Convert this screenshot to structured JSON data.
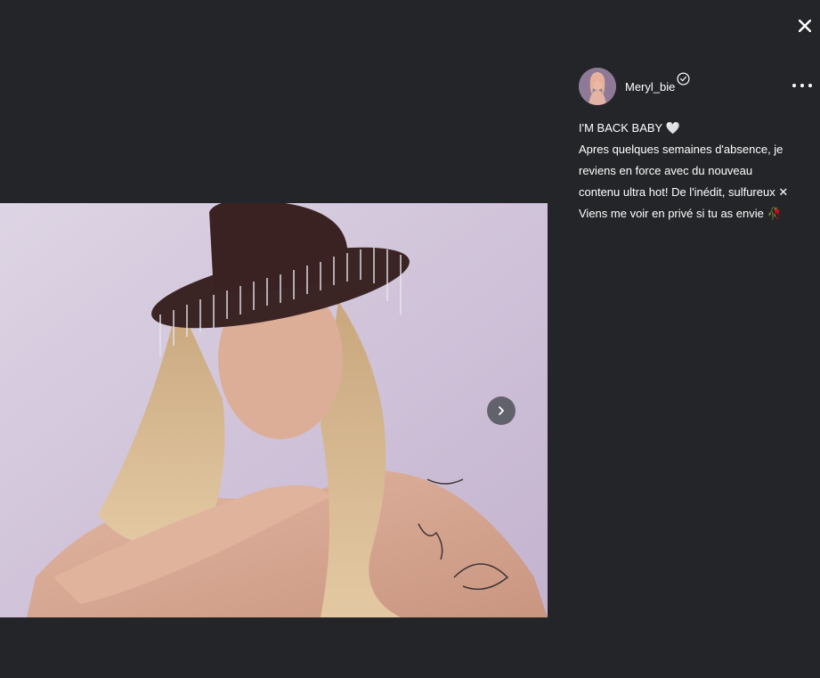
{
  "post": {
    "author": {
      "username": "Meryl_bie",
      "verified": true
    },
    "caption": {
      "line1": "I'M BACK BABY",
      "line1_emoji": "🤍",
      "line2": "Apres quelques semaines d'absence, je",
      "line3": "reviens en force avec du nouveau",
      "line4": "contenu ultra hot! De l'inédit, sulfureux",
      "line4_emoji": "✕",
      "line5": "Viens me voir en privé si tu as envie",
      "line5_emoji": "🥀"
    }
  },
  "icons": {
    "close": "close-icon",
    "next": "chevron-right-icon",
    "more": "more-horizontal-icon",
    "verified": "verified-badge-icon"
  },
  "colors": {
    "background": "#232528",
    "text": "#ffffff",
    "next_button": "#50525a"
  }
}
